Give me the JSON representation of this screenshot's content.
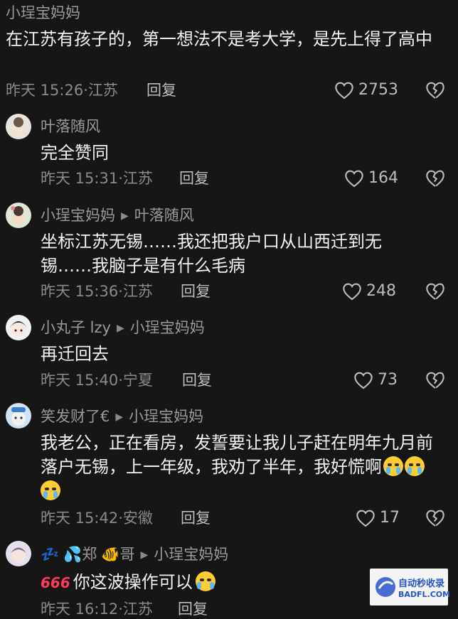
{
  "comments": [
    {
      "author": "小珵宝妈妈",
      "text": "在江苏有孩子的，第一想法不是考大学，是先上得了高中",
      "time": "昨天 15:26",
      "location": "江苏",
      "reply_label": "回复",
      "likes": "2753"
    },
    {
      "author": "叶落随风",
      "text": "完全赞同",
      "time": "昨天 15:31",
      "location": "江苏",
      "reply_label": "回复",
      "likes": "164"
    },
    {
      "author": "小珵宝妈妈",
      "reply_to": "叶落随风",
      "text": "坐标江苏无锡……我还把我户口从山西迁到无锡……我脑子是有什么毛病",
      "time": "昨天 15:36",
      "location": "江苏",
      "reply_label": "回复",
      "likes": "248"
    },
    {
      "author": "小丸子 lzy",
      "reply_to": "小珵宝妈妈",
      "text": "再迁回去",
      "time": "昨天 15:40",
      "location": "宁夏",
      "reply_label": "回复",
      "likes": "73"
    },
    {
      "author": "笑发财了€",
      "reply_to": "小珵宝妈妈",
      "text": "我老公，正在看房，发誓要让我儿子赶在明年九月前落户无锡，上一年级，我劝了半年，我好慌啊",
      "time": "昨天 15:42",
      "location": "安徽",
      "reply_label": "回复",
      "likes": "17"
    },
    {
      "author_prefix": "💤",
      "author_mid": "💦郑",
      "author_suffix": "🐠哥",
      "reply_to": "小珵宝妈妈",
      "badge": "666",
      "text": "你这波操作可以",
      "time": "昨天 16:12",
      "location": "江苏",
      "reply_label": "回复"
    }
  ],
  "separator": "·",
  "watermark": {
    "line1": "自动秒收录",
    "line2": "BADFL.COM"
  },
  "colors": {
    "background": "#161616",
    "author": "#9a9a9a",
    "text": "#f2f2f2",
    "meta": "#8a8a8a"
  }
}
